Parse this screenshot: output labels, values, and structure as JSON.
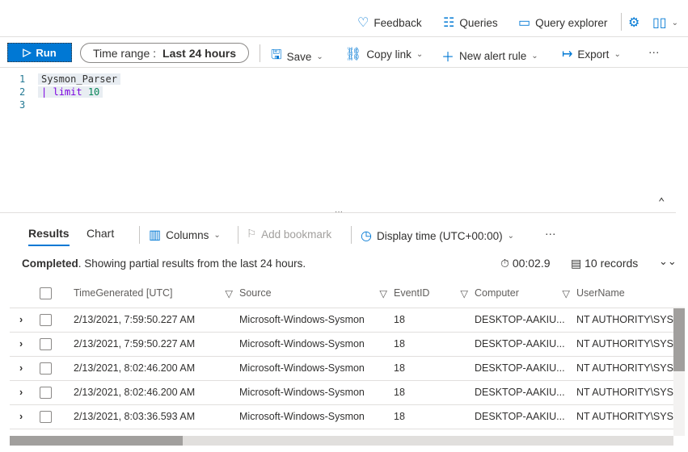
{
  "header": {
    "feedback": "Feedback",
    "queries": "Queries",
    "query_explorer": "Query explorer"
  },
  "toolbar": {
    "run": "Run",
    "time_range_label": "Time range :",
    "time_range_value": "Last 24 hours",
    "save": "Save",
    "copy_link": "Copy link",
    "new_alert_rule": "New alert rule",
    "export": "Export",
    "more": "···"
  },
  "editor": {
    "lines": [
      {
        "n": "1",
        "text": "Sysmon_Parser"
      },
      {
        "n": "2",
        "pipe": "|",
        "kw": "limit",
        "num": "10"
      },
      {
        "n": "3"
      }
    ]
  },
  "results": {
    "tabs": [
      "Results",
      "Chart"
    ],
    "columns": "Columns",
    "add_bookmark": "Add bookmark",
    "display_time": "Display time (UTC+00:00)",
    "more": "···",
    "status_bold": "Completed",
    "status_text": ". Showing partial results from the last 24 hours.",
    "duration": "00:02.9",
    "records": "10 records"
  },
  "table": {
    "headers": [
      "TimeGenerated [UTC]",
      "Source",
      "EventID",
      "Computer",
      "UserName"
    ],
    "rows": [
      [
        "2/13/2021, 7:59:50.227 AM",
        "Microsoft-Windows-Sysmon",
        "18",
        "DESKTOP-AAKIU...",
        "NT AUTHORITY\\SYSTEM"
      ],
      [
        "2/13/2021, 7:59:50.227 AM",
        "Microsoft-Windows-Sysmon",
        "18",
        "DESKTOP-AAKIU...",
        "NT AUTHORITY\\SYSTEM"
      ],
      [
        "2/13/2021, 8:02:46.200 AM",
        "Microsoft-Windows-Sysmon",
        "18",
        "DESKTOP-AAKIU...",
        "NT AUTHORITY\\SYSTEM"
      ],
      [
        "2/13/2021, 8:02:46.200 AM",
        "Microsoft-Windows-Sysmon",
        "18",
        "DESKTOP-AAKIU...",
        "NT AUTHORITY\\SYSTEM"
      ],
      [
        "2/13/2021, 8:03:36.593 AM",
        "Microsoft-Windows-Sysmon",
        "18",
        "DESKTOP-AAKIU...",
        "NT AUTHORITY\\SYSTEM"
      ]
    ]
  },
  "colors": {
    "accent": "#0078d4"
  }
}
